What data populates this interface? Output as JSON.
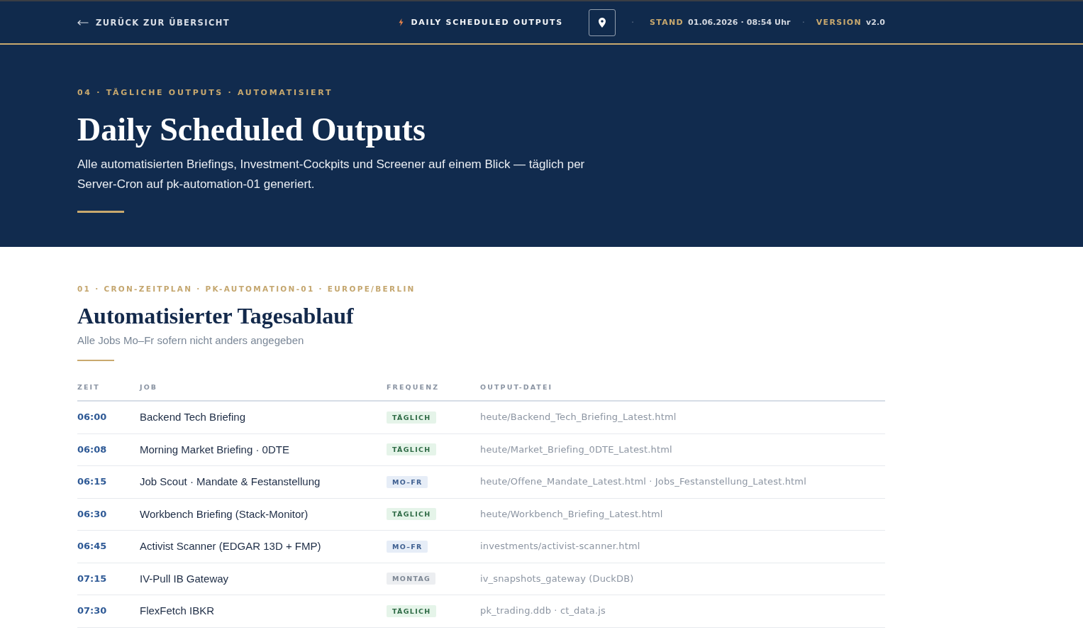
{
  "nav": {
    "back_link": "ZURÜCK ZUR ÜBERSICHT",
    "title": "DAILY SCHEDULED OUTPUTS",
    "meta": [
      {
        "separator": "·",
        "label": "STAND",
        "value": "01.06.2026 · 08:54 Uhr"
      },
      {
        "separator": "·",
        "label": "VERSION",
        "value": "v2.0"
      }
    ]
  },
  "hero": {
    "eyebrow": "04 · TÄGLICHE OUTPUTS · AUTOMATISIERT",
    "title": "Daily Scheduled Outputs",
    "description": "Alle automatisierten Briefings, Investment-Cockpits und Screener auf einem Blick — täglich per Server-Cron auf pk-automation-01 generiert."
  },
  "schedule": {
    "eyebrow": "01 · CRON-ZEITPLAN · PK-AUTOMATION-01 · EUROPE/BERLIN",
    "title": "Automatisierter Tagesablauf",
    "subtitle": "Alle Jobs Mo–Fr sofern nicht anders angegeben",
    "table": {
      "columns": [
        "ZEIT",
        "JOB",
        "FREQUENZ",
        "OUTPUT-DATEI"
      ],
      "rows": [
        {
          "time": "06:00",
          "job": "Backend Tech Briefing",
          "frequency": {
            "label": "TÄGLICH",
            "kind": "daily"
          },
          "output": "heute/Backend_Tech_Briefing_Latest.html"
        },
        {
          "time": "06:08",
          "job": "Morning Market Briefing · 0DTE",
          "frequency": {
            "label": "TÄGLICH",
            "kind": "daily"
          },
          "output": "heute/Market_Briefing_0DTE_Latest.html"
        },
        {
          "time": "06:15",
          "job": "Job Scout · Mandate & Festanstellung",
          "frequency": {
            "label": "MO–FR",
            "kind": "weekdays"
          },
          "output": "heute/Offene_Mandate_Latest.html · Jobs_Festanstellung_Latest.html"
        },
        {
          "time": "06:30",
          "job": "Workbench Briefing (Stack-Monitor)",
          "frequency": {
            "label": "TÄGLICH",
            "kind": "daily"
          },
          "output": "heute/Workbench_Briefing_Latest.html"
        },
        {
          "time": "06:45",
          "job": "Activist Scanner (EDGAR 13D + FMP)",
          "frequency": {
            "label": "MO–FR",
            "kind": "weekdays"
          },
          "output": "investments/activist-scanner.html"
        },
        {
          "time": "07:15",
          "job": "IV-Pull IB Gateway",
          "frequency": {
            "label": "MONTAG",
            "kind": "weekly"
          },
          "output": "iv_snapshots_gateway (DuckDB)"
        },
        {
          "time": "07:30",
          "job": "FlexFetch IBKR",
          "frequency": {
            "label": "TÄGLICH",
            "kind": "daily"
          },
          "output": "pk_trading.ddb · ct_data.js"
        }
      ]
    }
  }
}
